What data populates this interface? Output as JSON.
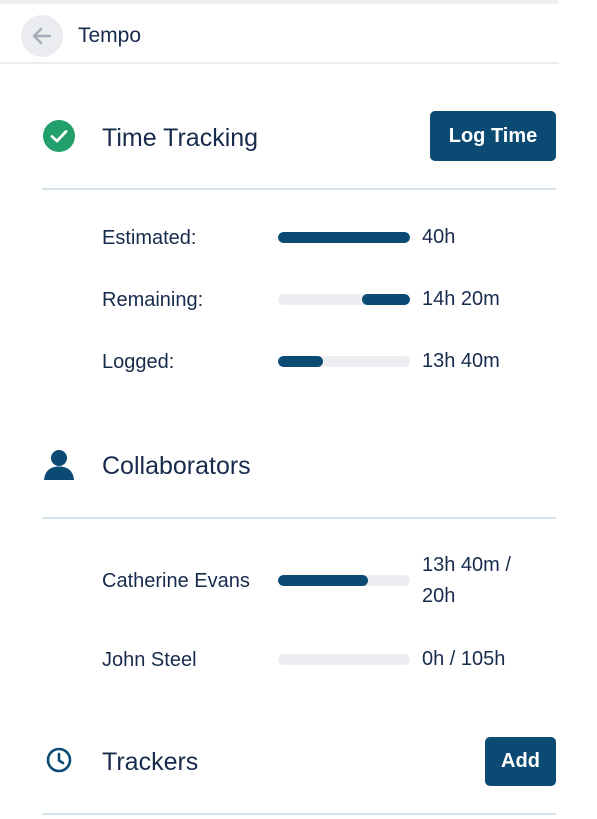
{
  "header": {
    "title": "Tempo",
    "back_icon": "arrow-left-icon"
  },
  "time_tracking": {
    "title": "Time Tracking",
    "icon": "check-circle-icon",
    "icon_color": "#22a06b",
    "log_time_label": "Log Time",
    "rows": [
      {
        "label": "Estimated:",
        "value": "40h",
        "fill_start": 0,
        "fill_fraction": 1.0
      },
      {
        "label": "Remaining:",
        "value": "14h 20m",
        "fill_start": 0.64,
        "fill_fraction": 0.36
      },
      {
        "label": "Logged:",
        "value": "13h 40m",
        "fill_start": 0,
        "fill_fraction": 0.34
      }
    ]
  },
  "collaborators": {
    "title": "Collaborators",
    "icon": "person-icon",
    "rows": [
      {
        "name": "Catherine Evans",
        "value_line1": "13h 40m /",
        "value_line2": "20h",
        "fill_fraction": 0.68
      },
      {
        "name": "John Steel",
        "value": "0h / 105h",
        "fill_fraction": 0
      }
    ]
  },
  "trackers": {
    "title": "Trackers",
    "icon": "clock-icon",
    "add_label": "Add"
  },
  "colors": {
    "primary": "#0a4a73",
    "track": "#eceef1",
    "text": "#172b4d",
    "divider": "#d7e3ea"
  }
}
